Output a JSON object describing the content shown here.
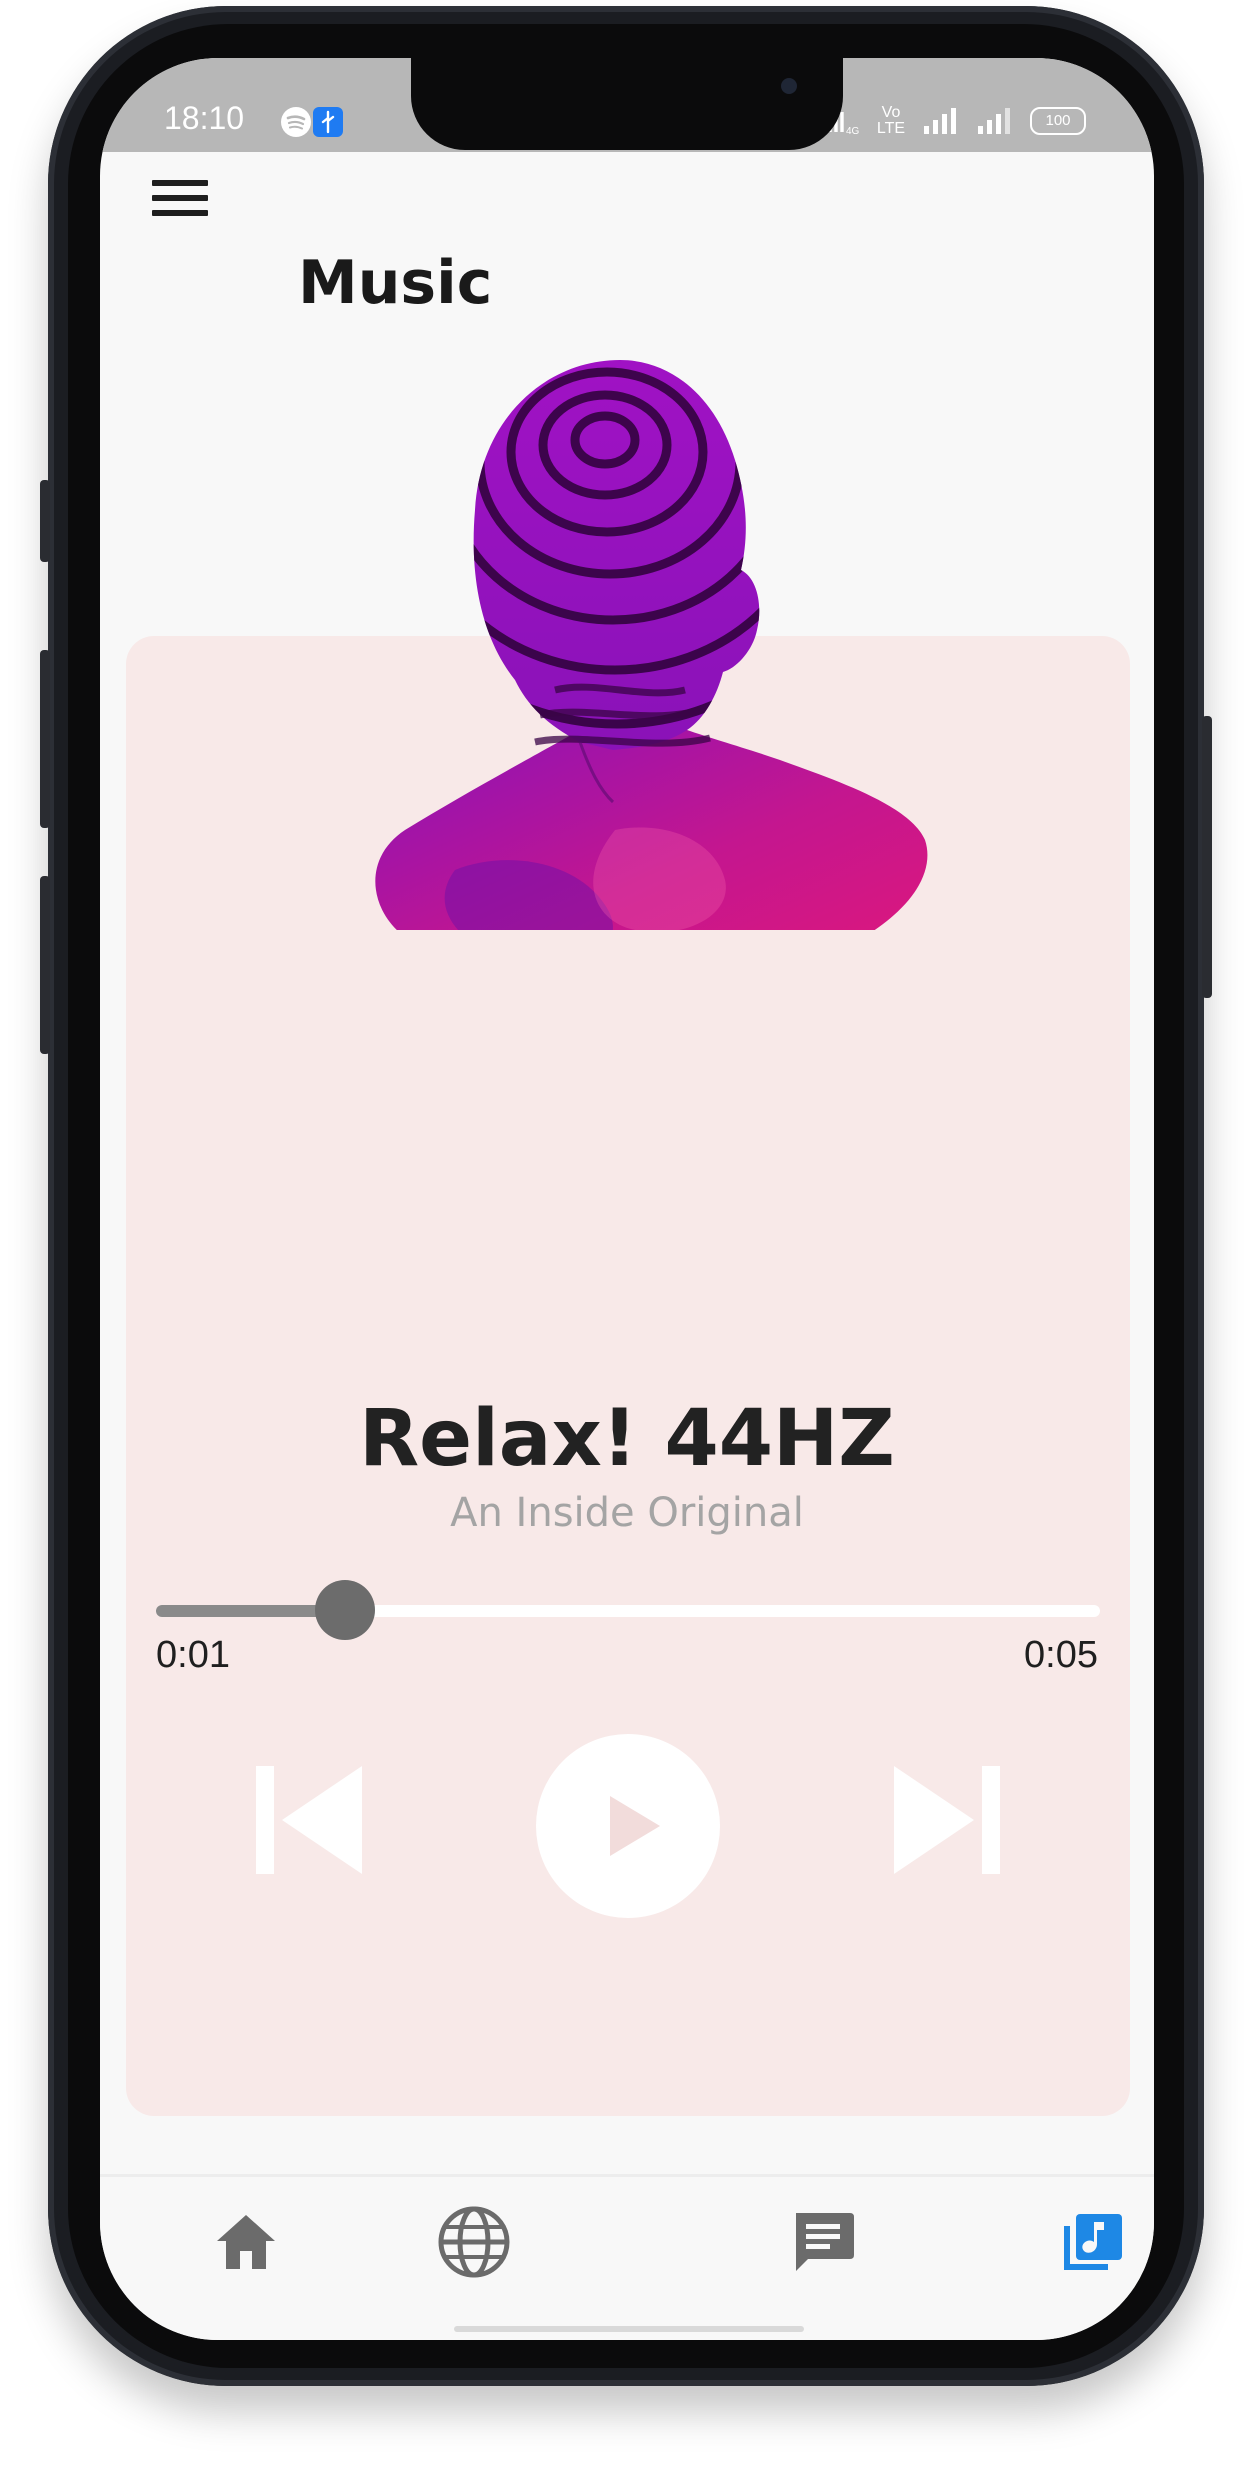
{
  "status_bar": {
    "time": "18:10",
    "indicators": [
      "Vo LTE",
      "100"
    ],
    "icons": [
      "spotify-icon",
      "usb-debug-icon",
      "hotspot-icon",
      "signal-icon",
      "signal-icon",
      "battery-icon"
    ]
  },
  "app_bar": {
    "title": "Music",
    "menu_icon": "hamburger-menu-icon"
  },
  "player": {
    "album_art": "purple-magenta-head-sculpture",
    "track_title": "Relax! 44HZ",
    "track_subtitle": "An Inside Original",
    "progress_fraction": 0.2,
    "time_current": "0:01",
    "time_total": "0:05",
    "controls": [
      "skip-previous-icon",
      "play-icon",
      "skip-next-icon"
    ]
  },
  "bottom_nav": {
    "items": [
      {
        "name": "home",
        "icon": "home-icon",
        "active": false
      },
      {
        "name": "explore",
        "icon": "globe-icon",
        "active": false
      },
      {
        "name": "messages",
        "icon": "chat-icon",
        "active": false
      },
      {
        "name": "music",
        "icon": "music-library-icon",
        "active": true
      }
    ]
  },
  "colors": {
    "card_background": "#f8e9e8",
    "active_nav": "#1e88e5",
    "inactive_nav": "#6b6b6b",
    "status_bar": "#b7b7b7",
    "art_magenta": "#e0187a",
    "art_purple": "#8a12b8"
  }
}
